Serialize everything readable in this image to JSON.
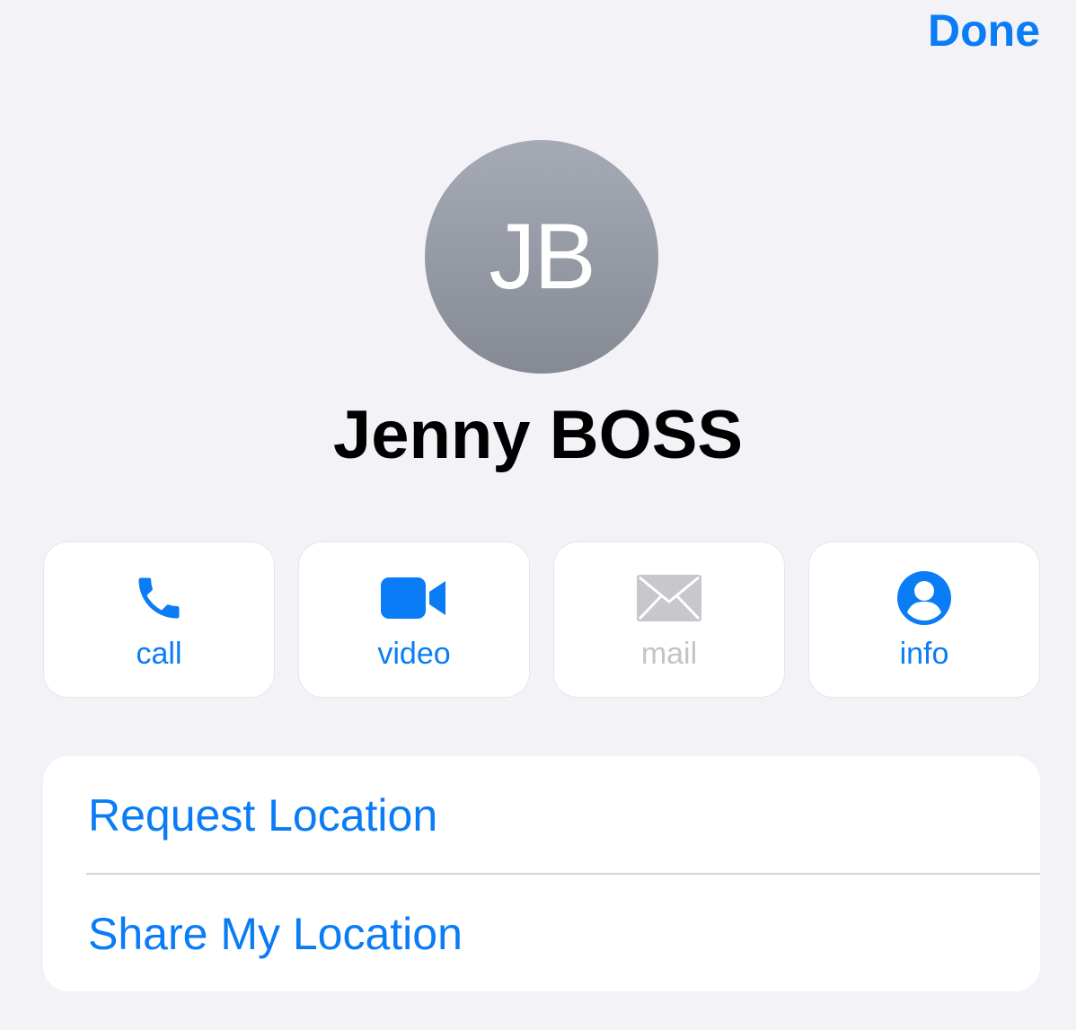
{
  "header": {
    "done_label": "Done"
  },
  "contact": {
    "initials": "JB",
    "name": "Jenny BOSS"
  },
  "actions": [
    {
      "label": "call",
      "icon": "phone-icon",
      "enabled": true
    },
    {
      "label": "video",
      "icon": "video-camera-icon",
      "enabled": true
    },
    {
      "label": "mail",
      "icon": "envelope-icon",
      "enabled": false
    },
    {
      "label": "info",
      "icon": "person-circle-icon",
      "enabled": true
    }
  ],
  "location": {
    "request_label": "Request Location",
    "share_label": "Share My Location"
  },
  "colors": {
    "accent": "#0a7cf5",
    "disabled": "#c4c4c8",
    "background": "#f2f2f7",
    "avatar_top": "#a5aab5",
    "avatar_bottom": "#868a94"
  }
}
